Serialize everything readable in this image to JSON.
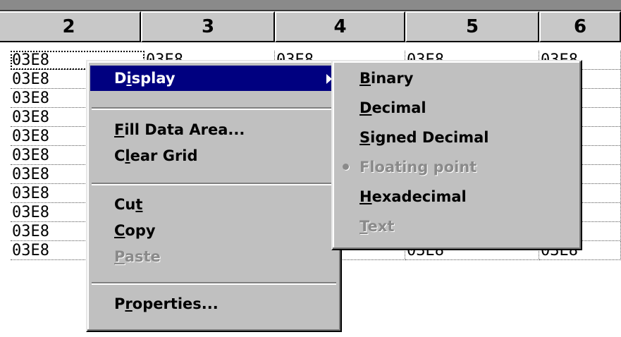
{
  "grid": {
    "columns": [
      "2",
      "3",
      "4",
      "5",
      "6"
    ],
    "cell_value": "03E8",
    "rows": 11
  },
  "context_menu": {
    "items": [
      {
        "label": "Display",
        "mnemonic_index": 1,
        "has_submenu": true,
        "selected": true,
        "disabled": false
      },
      {
        "separator": true
      },
      {
        "label": "Fill Data Area...",
        "mnemonic_index": 0,
        "disabled": false
      },
      {
        "label": "Clear Grid",
        "mnemonic_index": 1,
        "disabled": false
      },
      {
        "separator": true
      },
      {
        "label": "Cut",
        "mnemonic_index": 2,
        "disabled": false
      },
      {
        "label": "Copy",
        "mnemonic_index": 0,
        "disabled": false
      },
      {
        "label": "Paste",
        "mnemonic_index": 0,
        "disabled": true
      },
      {
        "separator": true
      },
      {
        "label": "Properties...",
        "mnemonic_index": 1,
        "disabled": false
      }
    ]
  },
  "display_submenu": {
    "items": [
      {
        "label": "Binary",
        "mnemonic_index": 0,
        "disabled": false,
        "checked": false
      },
      {
        "label": "Decimal",
        "mnemonic_index": 0,
        "disabled": false,
        "checked": false
      },
      {
        "label": "Signed Decimal",
        "mnemonic_index": 0,
        "disabled": false,
        "checked": false
      },
      {
        "label": "Floating point",
        "mnemonic_index": -1,
        "disabled": true,
        "checked": true
      },
      {
        "label": "Hexadecimal",
        "mnemonic_index": 0,
        "disabled": false,
        "checked": false
      },
      {
        "label": "Text",
        "mnemonic_index": 0,
        "disabled": true,
        "checked": false
      }
    ]
  },
  "colors": {
    "menu_bg": "#c0c0c0",
    "highlight": "#000080",
    "disabled_text": "#8a8a8a"
  }
}
